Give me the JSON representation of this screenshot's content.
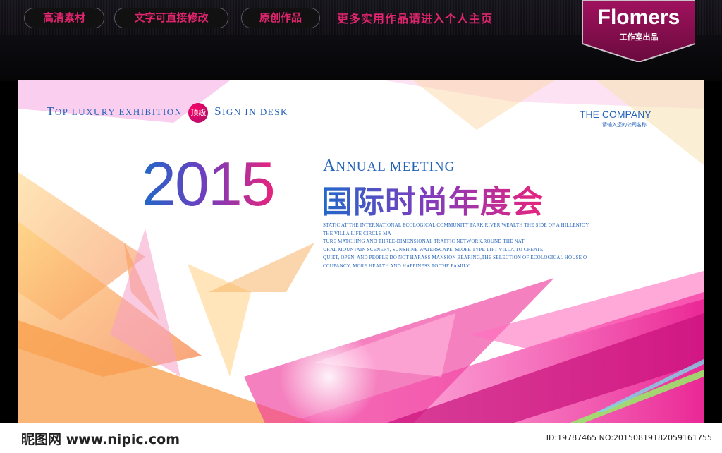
{
  "header": {
    "pills": [
      "高清素材",
      "文字可直接修改",
      "原创作品"
    ],
    "slogan": "更多实用作品请进入个人主页",
    "brand": "Flomers",
    "brand_sub": "工作室出品",
    "accent": "#e0246e"
  },
  "poster": {
    "tag": {
      "part1_big": "T",
      "part1": "OP LUXURY EXHIBITION",
      "badge": "顶级",
      "part2_big": "S",
      "part2": "IGN IN DESK"
    },
    "company": "THE COMPANY",
    "company_sub": "请输入您的公司名称",
    "year": "2015",
    "annual_cap": "A",
    "annual": "NNUAL  MEETING",
    "title_cn": "国际时尚年度会",
    "body_lines": [
      "STATIC AT THE INTERNATIONAL ECOLOGICAL COMMUNITY PARK RIVER WEALTH THE SIDE OF A HILLENJOY",
      "THE VILLA LIFE CIRCLE MA",
      "TURE MATCHING AND THREE-DIMENSIONAL TRAFFIC NETWORK,ROUND THE NAT",
      "URAL MOUNTAIN SCENERY, SUNSHINE WATERSCAPE, SLOPE TYPE LIFT VILLA,TO CREATE",
      "QUIET, OPEN, AND PEOPLE DO NOT HARASS MANSION BEARING,THE SELECTION OF ECOLOGICAL HOUSE O",
      "CCUPANCY, MORE HEALTH AND HAPPINESS TO THE FAMILY."
    ],
    "colors": {
      "blue": "#2463b8",
      "pink": "#e8247d",
      "orange": "#f5a24a"
    }
  },
  "footer": {
    "logo": "昵图网 www.nipic.com",
    "id": "ID:19787465 NO:20150819182059161755"
  }
}
